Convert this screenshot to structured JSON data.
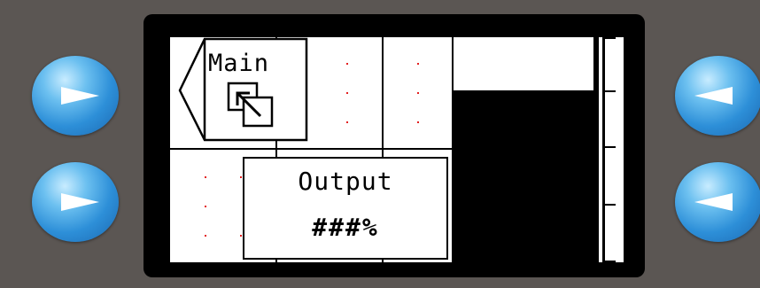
{
  "screen": {
    "main_tab_label": "Main",
    "main_tab_icon": "window-switch-icon",
    "output_title": "Output",
    "output_value": "###%"
  },
  "buttons": {
    "left_top_icon": "right-arrow-icon",
    "left_bottom_icon": "right-arrow-icon",
    "right_top_icon": "left-arrow-icon",
    "right_bottom_icon": "left-arrow-icon"
  },
  "colors": {
    "background": "#5b5653",
    "bezel": "#000000",
    "screen": "#ffffff",
    "button_blue": "#2d8fd8",
    "grid_dot": "#e32020"
  }
}
